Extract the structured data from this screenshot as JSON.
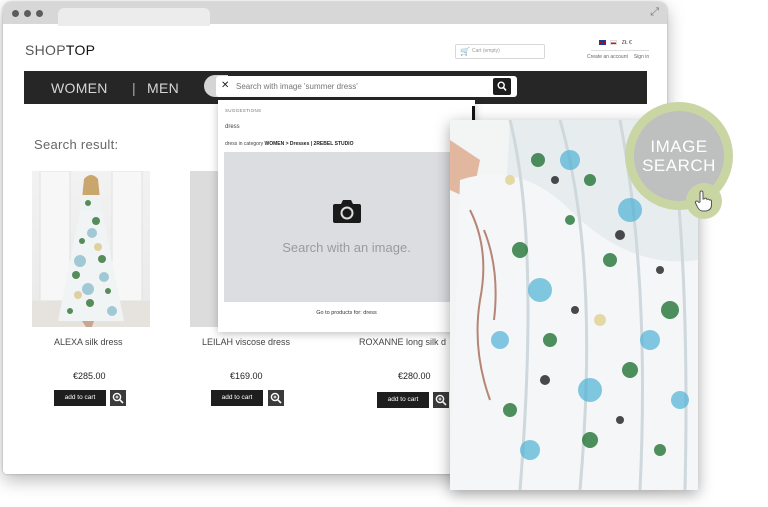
{
  "header": {
    "logo_part1": "SHOP",
    "logo_part2": "TOP",
    "cart_label": "Cart (empty)",
    "language_currency": "ZŁ €",
    "create_account": "Create an account",
    "sign_in": "Sign in"
  },
  "nav": {
    "items": [
      {
        "label": "WOMEN"
      },
      {
        "label": "MEN"
      }
    ],
    "separator": "|"
  },
  "search": {
    "clear_icon": "close-icon",
    "placeholder": "Search with image 'summer dress'",
    "button_icon": "search-icon"
  },
  "suggestions": {
    "heading": "SUGGESTIONS",
    "word": "dress",
    "category_prefix": "dress",
    "category_in": " in category ",
    "category_path": "WOMEN > Dresses | 2REBEL STUDIO",
    "drop_text": "Search with an image.",
    "drop_icon": "camera-icon",
    "go_to_products": "Go to products for: dress"
  },
  "results": {
    "title": "Search result:",
    "products": [
      {
        "name": "ALEXA silk dress",
        "price": "€285.00",
        "cart_label": "add to cart",
        "zoom_icon": "zoom-icon"
      },
      {
        "name": "LEILAH viscose dress",
        "price": "€169.00",
        "cart_label": "add to cart",
        "zoom_icon": "zoom-icon"
      },
      {
        "name": "ROXANNE long silk d",
        "price": "€280.00",
        "cart_label": "add to cart",
        "zoom_icon": "zoom-icon"
      }
    ]
  },
  "badge": {
    "line1": "IMAGE",
    "line2": "SEARCH",
    "icon": "pointer-hand-icon"
  },
  "colors": {
    "nav_bg": "#262626",
    "badge_ring": "#c9d6a4",
    "badge_fill": "#bebfbf",
    "button_bg": "#1e1e1e"
  }
}
